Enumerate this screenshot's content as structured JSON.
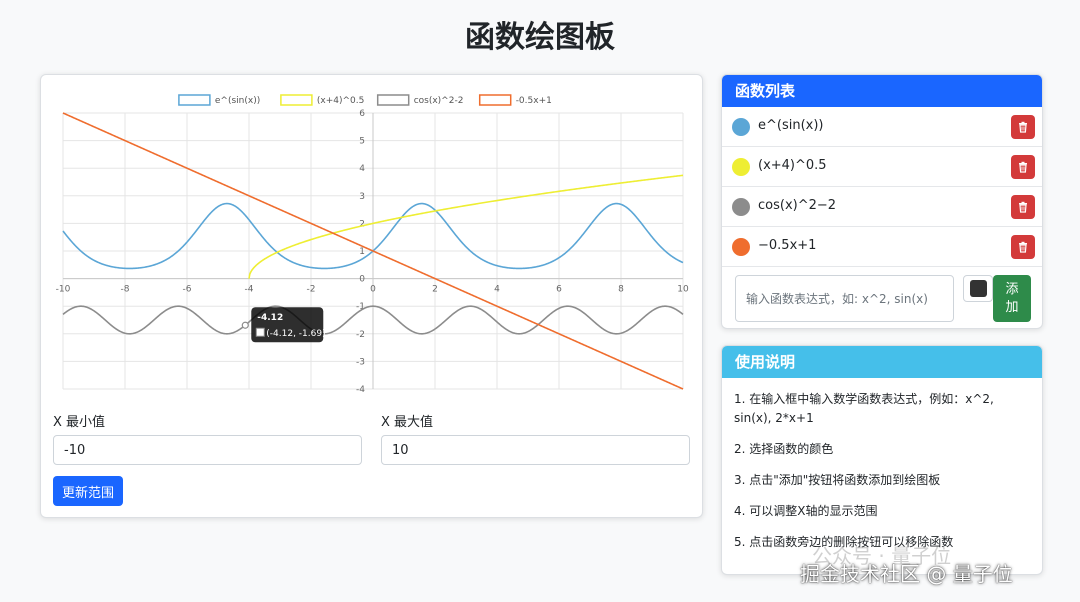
{
  "page": {
    "title": "函数绘图板"
  },
  "chart_data": {
    "type": "line",
    "xlim": [
      -10,
      10
    ],
    "ylim": [
      -4,
      6
    ],
    "x_ticks": [
      -10,
      -8,
      -6,
      -4,
      -2,
      0,
      2,
      4,
      6,
      8,
      10
    ],
    "y_ticks": [
      -4,
      -3,
      -2,
      -1,
      0,
      1,
      2,
      3,
      4,
      5,
      6
    ],
    "grid": true,
    "legend_position": "top-center",
    "series": [
      {
        "name": "e^(sin(x))",
        "color": "#5ba6d6",
        "expr": "exp(sin(x))"
      },
      {
        "name": "(x+4)^0.5",
        "color": "#eeee33",
        "expr": "sqrt(x+4)"
      },
      {
        "name": "cos(x)^2-2",
        "color": "#8c8c8c",
        "expr": "cos(x)^2-2"
      },
      {
        "name": "-0.5x+1",
        "color": "#ef6d2e",
        "expr": "-0.5*x+1"
      }
    ],
    "tooltip": {
      "title": "-4.12",
      "label": "(-4.12, -1.69)",
      "x": -4.12,
      "y": -1.69
    }
  },
  "range": {
    "x_min_label": "X 最小值",
    "x_min_value": "-10",
    "x_max_label": "X 最大值",
    "x_max_value": "10",
    "update_button": "更新范围"
  },
  "function_list": {
    "header": "函数列表",
    "header_color": "#1a66ff",
    "items": [
      {
        "label": "e^(sin(x))",
        "color": "#5ba6d6"
      },
      {
        "label": "(x+4)^0.5",
        "color": "#eeee33"
      },
      {
        "label": "cos(x)^2−2",
        "color": "#8c8c8c"
      },
      {
        "label": "−0.5x+1",
        "color": "#ef6d2e"
      }
    ],
    "input_placeholder": "输入函数表达式，如: x^2, sin(x)",
    "picked_color": "#333333",
    "add_button": "添\n加"
  },
  "help": {
    "header": "使用说明",
    "header_color": "#45bfea",
    "items": [
      "1. 在输入框中输入数学函数表达式，例如：x^2, sin(x), 2*x+1",
      "2. 选择函数的颜色",
      "3. 点击\"添加\"按钮将函数添加到绘图板",
      "4. 可以调整X轴的显示范围",
      "5. 点击函数旁边的删除按钮可以移除函数"
    ]
  },
  "watermark": {
    "line1": "公众号 · 量子位",
    "line2": "掘金技术社区 @ 量子位"
  }
}
